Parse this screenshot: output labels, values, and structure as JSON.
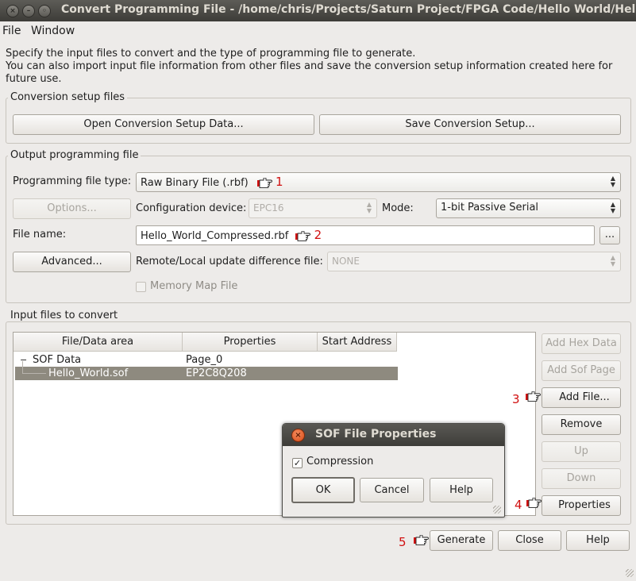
{
  "window": {
    "title": "Convert Programming File - /home/chris/Projects/Saturn Project/FPGA Code/Hello World/Hello",
    "controls": [
      "×",
      "–",
      "◦"
    ]
  },
  "menubar": {
    "file": "File",
    "window": "Window"
  },
  "intro": {
    "line1": "Specify the input files to convert and the type of programming file to generate.",
    "line2": "You can also import input file information from other files and save the conversion setup information created here for",
    "line3": "future use."
  },
  "conversion_setup": {
    "title": "Conversion setup files",
    "open_button": "Open Conversion Setup Data...",
    "save_button": "Save Conversion Setup..."
  },
  "output": {
    "title": "Output programming file",
    "file_type_label": "Programming file type:",
    "file_type_value": "Raw Binary File (.rbf)",
    "options_button": "Options...",
    "config_device_label": "Configuration device:",
    "config_device_value": "EPC16",
    "mode_label": "Mode:",
    "mode_value": "1-bit Passive Serial",
    "file_name_label": "File name:",
    "file_name_value": "Hello_World_Compressed.rbf",
    "browse_button": "...",
    "advanced_button": "Advanced...",
    "remote_label": "Remote/Local update difference file:",
    "remote_value": "NONE",
    "memory_map_label": "Memory Map File"
  },
  "input": {
    "title": "Input files to convert",
    "columns": [
      "File/Data area",
      "Properties",
      "Start Address"
    ],
    "rows": [
      {
        "name": "SOF Data",
        "properties": "Page_0",
        "address": ""
      },
      {
        "name": "Hello_World.sof",
        "properties": "EP2C8Q208",
        "address": ""
      }
    ],
    "tree_expander": "−",
    "buttons": {
      "add_hex": "Add Hex Data",
      "add_sof": "Add Sof Page",
      "add_file": "Add File...",
      "remove": "Remove",
      "up": "Up",
      "down": "Down",
      "properties": "Properties"
    }
  },
  "dialog": {
    "title": "SOF File Properties",
    "close_glyph": "×",
    "compression_label": "Compression",
    "compression_checked": true,
    "check_glyph": "✓",
    "ok": "OK",
    "cancel": "Cancel",
    "help": "Help"
  },
  "bottom": {
    "generate": "Generate",
    "close": "Close",
    "help": "Help"
  },
  "annotations": {
    "n1": "1",
    "n2": "2",
    "n3": "3",
    "n4": "4",
    "n5": "5"
  },
  "colors": {
    "annotation": "#d11010",
    "selection": "#8e8a7f",
    "titlebar": "#3d3c38"
  },
  "icons": {
    "pointer": "pointing-hand-icon",
    "combo_arrow": "up-down-arrow-icon"
  }
}
